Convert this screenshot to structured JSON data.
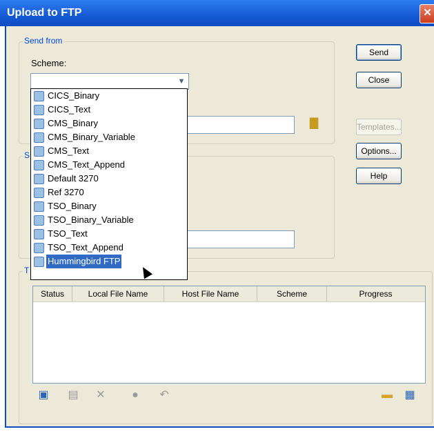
{
  "window": {
    "title": "Upload to FTP",
    "close_glyph": "✕"
  },
  "send_from": {
    "group_label": "Send from",
    "scheme_label": "Scheme:",
    "scheme_value": "",
    "scheme_options": [
      "CICS_Binary",
      "CICS_Text",
      "CMS_Binary",
      "CMS_Binary_Variable",
      "CMS_Text",
      "CMS_Text_Append",
      "Default 3270",
      "Ref 3270",
      "TSO_Binary",
      "TSO_Binary_Variable",
      "TSO_Text",
      "TSO_Text_Append",
      "Hummingbird FTP"
    ],
    "highlighted_option": "Hummingbird FTP"
  },
  "send_to": {
    "group_label_fragment": "S"
  },
  "transfer": {
    "group_label_fragment": "T"
  },
  "buttons": {
    "send": "Send",
    "close": "Close",
    "templates": "Templates...",
    "options": "Options...",
    "help": "Help"
  },
  "table": {
    "columns": [
      "Status",
      "Local File Name",
      "Host File Name",
      "Scheme",
      "Progress"
    ],
    "rows": []
  },
  "toolbar": {
    "icons": [
      "add-file-icon",
      "edit-icon",
      "delete-icon",
      "settings-icon",
      "undo-icon",
      "open-folder-icon",
      "save-icon"
    ],
    "delete_glyph": "✕",
    "undo_glyph": "↶"
  },
  "colors": {
    "titlebar": "#1559d4",
    "selection": "#316ac5",
    "group_label": "#0046d5"
  }
}
